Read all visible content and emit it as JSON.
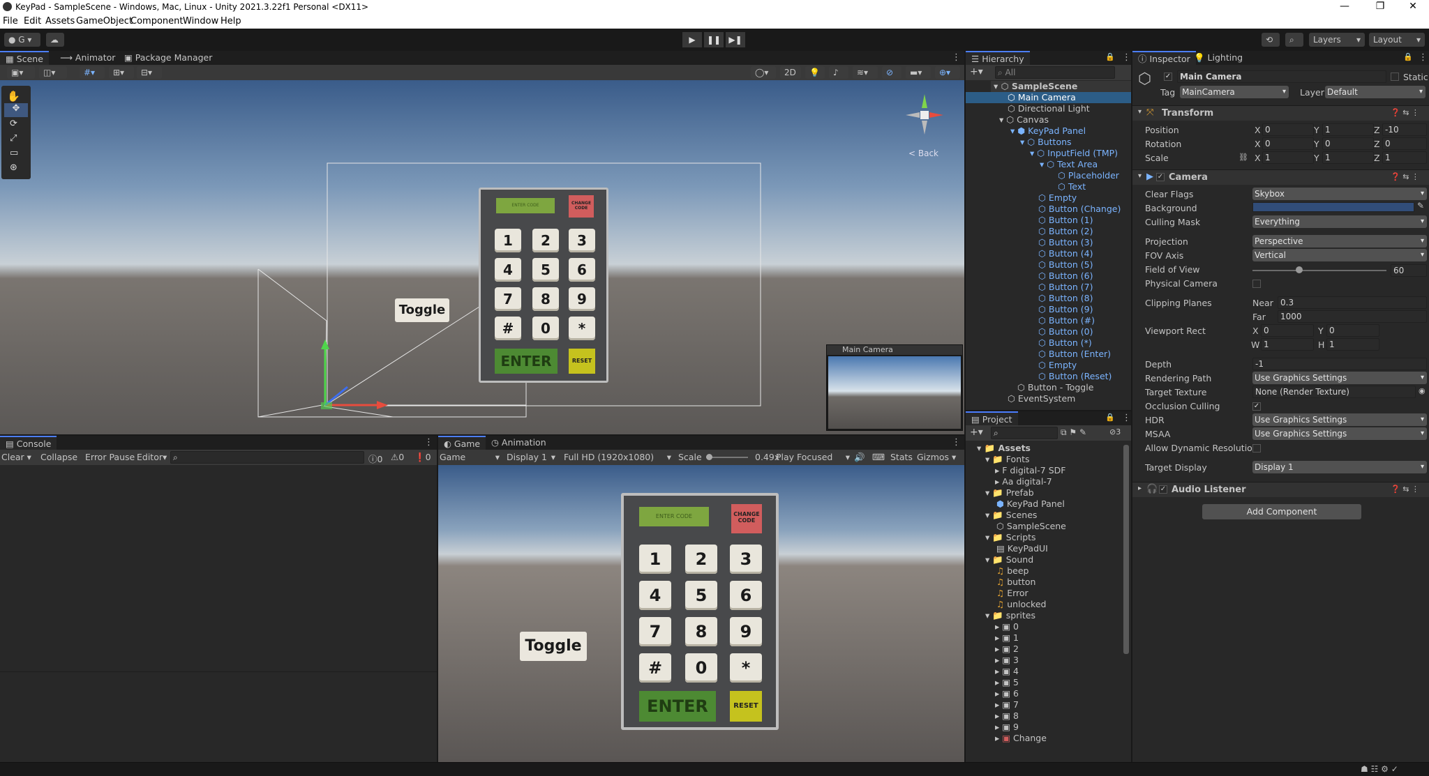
{
  "window": {
    "title": "KeyPad - SampleScene - Windows, Mac, Linux - Unity 2021.3.22f1 Personal <DX11>",
    "min": "—",
    "max": "❐",
    "close": "✕"
  },
  "menu": [
    "File",
    "Edit",
    "Assets",
    "GameObject",
    "Component",
    "Window",
    "Help"
  ],
  "toolbar": {
    "account": "G",
    "layers": "Layers",
    "layout": "Layout",
    "play": "▶",
    "pause": "❚❚",
    "step": "▶❚"
  },
  "scene_tabs": [
    "Scene",
    "Animator",
    "Package Manager"
  ],
  "scene": {
    "mode2d": "2D",
    "toggle": "Toggle",
    "back": "< Back",
    "preview_title": "Main Camera"
  },
  "keypad": {
    "display": "ENTER CODE",
    "change": "CHANGE CODE",
    "keys": [
      "1",
      "2",
      "3",
      "4",
      "5",
      "6",
      "7",
      "8",
      "9",
      "#",
      "0",
      "*"
    ],
    "enter": "ENTER",
    "reset": "RESET"
  },
  "hierarchy": {
    "title": "Hierarchy",
    "search": "All",
    "items": [
      "SampleScene",
      "Main Camera",
      "Directional Light",
      "Canvas",
      "KeyPad Panel",
      "Buttons",
      "InputField (TMP)",
      "Text Area",
      "Placeholder",
      "Text",
      "Empty",
      "Button (Change)",
      "Button (1)",
      "Button (2)",
      "Button (3)",
      "Button (4)",
      "Button (5)",
      "Button (6)",
      "Button (7)",
      "Button (8)",
      "Button (9)",
      "Button (#)",
      "Button (0)",
      "Button (*)",
      "Button (Enter)",
      "Empty",
      "Button (Reset)",
      "Button - Toggle",
      "EventSystem"
    ]
  },
  "project": {
    "title": "Project",
    "count": "3",
    "items": [
      "Assets",
      "Fonts",
      "digital-7 SDF",
      "digital-7",
      "Prefab",
      "KeyPad Panel",
      "Scenes",
      "SampleScene",
      "Scripts",
      "KeyPadUI",
      "Sound",
      "beep",
      "button",
      "Error",
      "unlocked",
      "sprites",
      "0",
      "1",
      "2",
      "3",
      "4",
      "5",
      "6",
      "7",
      "8",
      "9",
      "Change"
    ]
  },
  "console": {
    "title": "Console",
    "clear": "Clear",
    "collapse": "Collapse",
    "error_pause": "Error Pause",
    "editor": "Editor",
    "c1": "0",
    "c2": "0",
    "c3": "0"
  },
  "game": {
    "tabs": [
      "Game",
      "Animation"
    ],
    "game": "Game",
    "display": "Display 1",
    "res": "Full HD (1920x1080)",
    "scale_label": "Scale",
    "scale": "0.49x",
    "play_focused": "Play Focused",
    "stats": "Stats",
    "gizmos": "Gizmos",
    "toggle": "Toggle"
  },
  "inspector": {
    "tabs": [
      "Inspector",
      "Lighting"
    ],
    "name": "Main Camera",
    "static": "Static",
    "tag_label": "Tag",
    "tag": "MainCamera",
    "layer_label": "Layer",
    "layer": "Default",
    "transform": {
      "title": "Transform",
      "position": "Position",
      "rotation": "Rotation",
      "scale": "Scale",
      "pos": [
        "0",
        "1",
        "-10"
      ],
      "rot": [
        "0",
        "0",
        "0"
      ],
      "scl": [
        "1",
        "1",
        "1"
      ]
    },
    "camera": {
      "title": "Camera",
      "clear_flags": "Clear Flags",
      "clear_flags_v": "Skybox",
      "background": "Background",
      "culling": "Culling Mask",
      "culling_v": "Everything",
      "projection": "Projection",
      "projection_v": "Perspective",
      "fov_axis": "FOV Axis",
      "fov_axis_v": "Vertical",
      "fov": "Field of View",
      "fov_v": "60",
      "physical": "Physical Camera",
      "clipping": "Clipping Planes",
      "near": "Near",
      "near_v": "0.3",
      "far": "Far",
      "far_v": "1000",
      "viewport": "Viewport Rect",
      "vx": "0",
      "vy": "0",
      "vw": "1",
      "vh": "1",
      "depth": "Depth",
      "depth_v": "-1",
      "rpath": "Rendering Path",
      "rpath_v": "Use Graphics Settings",
      "ttex": "Target Texture",
      "ttex_v": "None (Render Texture)",
      "occl": "Occlusion Culling",
      "hdr": "HDR",
      "hdr_v": "Use Graphics Settings",
      "msaa": "MSAA",
      "msaa_v": "Use Graphics Settings",
      "adr": "Allow Dynamic Resolution",
      "tdisp": "Target Display",
      "tdisp_v": "Display 1"
    },
    "audio": "Audio Listener",
    "add": "Add Component"
  },
  "axes": {
    "x": "X",
    "y": "Y",
    "z": "Z",
    "w": "W",
    "h": "H"
  },
  "colors": {
    "accent": "#4c7eff",
    "camera_bg": "#314d79"
  }
}
